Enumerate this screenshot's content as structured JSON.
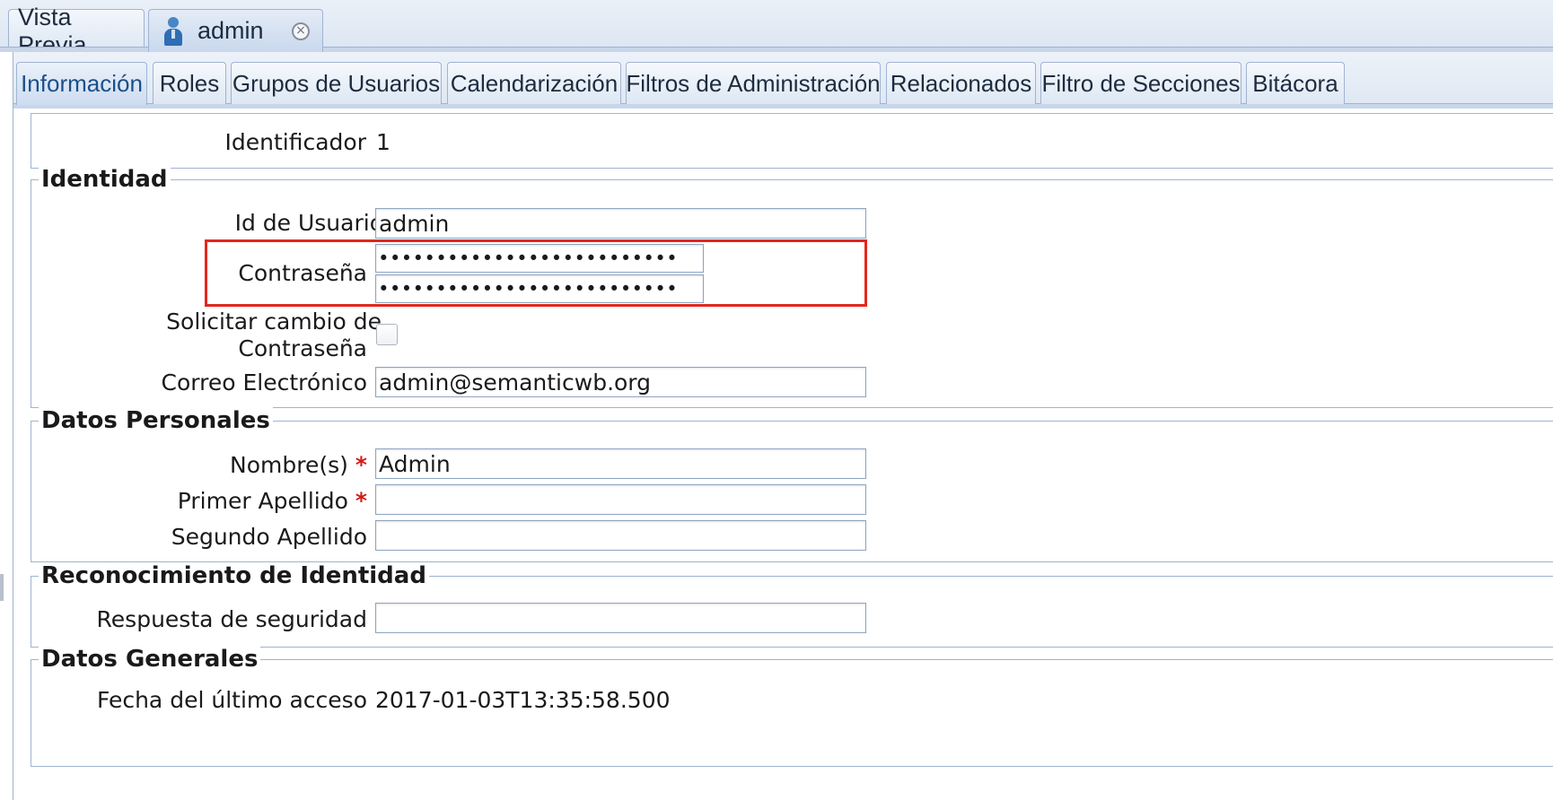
{
  "outer_tabs": [
    {
      "label": "Vista Previa"
    },
    {
      "label": "admin",
      "icon": "user-icon",
      "close_icon": "close-icon",
      "close_glyph": "×"
    }
  ],
  "inner_tabs": [
    {
      "label": "Información",
      "active": true
    },
    {
      "label": "Roles"
    },
    {
      "label": "Grupos de Usuarios"
    },
    {
      "label": "Calendarización"
    },
    {
      "label": "Filtros de Administración"
    },
    {
      "label": "Relacionados"
    },
    {
      "label": "Filtro de Secciones"
    },
    {
      "label": "Bitácora"
    }
  ],
  "identificador": {
    "label": "Identificador",
    "value": "1"
  },
  "identidad": {
    "legend": "Identidad",
    "user_id": {
      "label": "Id de Usuario",
      "required": "*",
      "value": "admin"
    },
    "password": {
      "label": "Contraseña",
      "masked": "••••••••••••••••••••••••••",
      "confirm_masked": "••••••••••••••••••••••••••"
    },
    "request_change": {
      "label_line1": "Solicitar cambio de",
      "label_line2": "Contraseña",
      "checked": false
    },
    "email": {
      "label": "Correo Electrónico",
      "value": "admin@semanticwb.org"
    }
  },
  "datos_personales": {
    "legend": "Datos Personales",
    "nombre": {
      "label": "Nombre(s)",
      "required": "*",
      "value": "Admin"
    },
    "primer_apellido": {
      "label": "Primer Apellido",
      "required": "*",
      "value": ""
    },
    "segundo_apellido": {
      "label": "Segundo Apellido",
      "value": ""
    }
  },
  "reconocimiento": {
    "legend": "Reconocimiento de Identidad",
    "respuesta": {
      "label": "Respuesta de seguridad",
      "value": ""
    }
  },
  "datos_generales": {
    "legend": "Datos Generales",
    "ultimo_acceso": {
      "label": "Fecha del último acceso",
      "value": "2017-01-03T13:35:58.500"
    }
  },
  "colors": {
    "highlight": "#e2271e",
    "required": "#d41b1b",
    "border": "#9fb3d2"
  }
}
